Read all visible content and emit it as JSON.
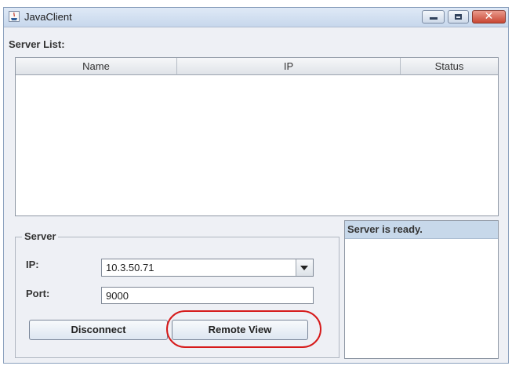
{
  "window": {
    "title": "JavaClient",
    "controls": {
      "minimize": "minimize-icon",
      "maximize": "maximize-icon",
      "close": "close-icon"
    }
  },
  "server_list": {
    "label": "Server List:",
    "columns": [
      "Name",
      "IP",
      "Status"
    ],
    "rows": []
  },
  "server": {
    "group_label": "Server",
    "ip_label": "IP:",
    "ip_value": "10.3.50.71",
    "port_label": "Port:",
    "port_value": "9000",
    "disconnect_label": "Disconnect",
    "remote_view_label": "Remote View"
  },
  "status": {
    "message": "Server is ready."
  },
  "colors": {
    "window_bg": "#eef0f5",
    "highlight": "#d61a1a",
    "status_header": "#c7d8ea"
  }
}
